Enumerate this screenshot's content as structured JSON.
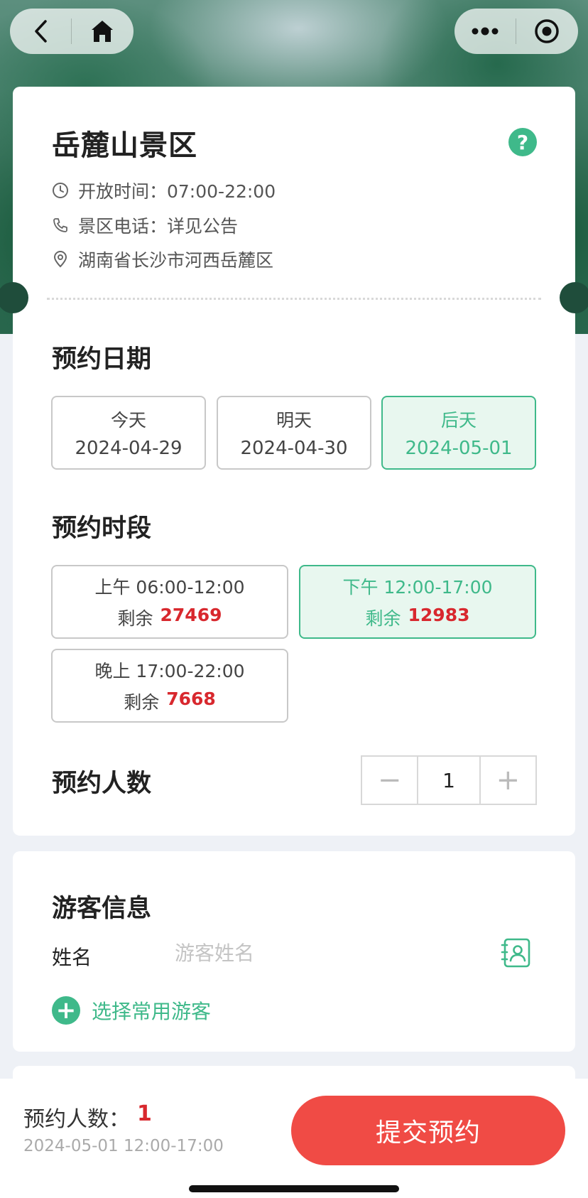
{
  "scenic": {
    "title": "岳麓山景区",
    "help": "?",
    "hours": "开放时间：07:00-22:00",
    "phone": "景区电话：详见公告",
    "address": "湖南省长沙市河西岳麓区"
  },
  "date_section": {
    "title": "预约日期",
    "options": [
      {
        "label": "今天",
        "date": "2024-04-29",
        "selected": false
      },
      {
        "label": "明天",
        "date": "2024-04-30",
        "selected": false
      },
      {
        "label": "后天",
        "date": "2024-05-01",
        "selected": true
      }
    ]
  },
  "slot_section": {
    "title": "预约时段",
    "remain_label": "剩余",
    "slots": [
      {
        "label": "上午 06:00-12:00",
        "remain": "27469",
        "selected": false
      },
      {
        "label": "下午 12:00-17:00",
        "remain": "12983",
        "selected": true
      },
      {
        "label": "晚上 17:00-22:00",
        "remain": "7668",
        "selected": false
      }
    ]
  },
  "people": {
    "title": "预约人数",
    "value": "1",
    "minus": "−",
    "plus": "+"
  },
  "visitor": {
    "title": "游客信息",
    "name_label": "姓名",
    "name_placeholder": "游客姓名",
    "add_label": "选择常用游客"
  },
  "bottom": {
    "count_label": "预约人数：",
    "count_value": "1",
    "selected_time": "2024-05-01 12:00-17:00",
    "submit": "提交预约"
  },
  "colors": {
    "accent": "#3fb98a",
    "danger": "#d8282e",
    "submit": "#f04b45"
  },
  "icons": [
    "back-icon",
    "home-icon",
    "more-icon",
    "record-icon",
    "clock-icon",
    "phone-icon",
    "location-icon",
    "help-icon",
    "contact-book-icon",
    "add-icon"
  ]
}
